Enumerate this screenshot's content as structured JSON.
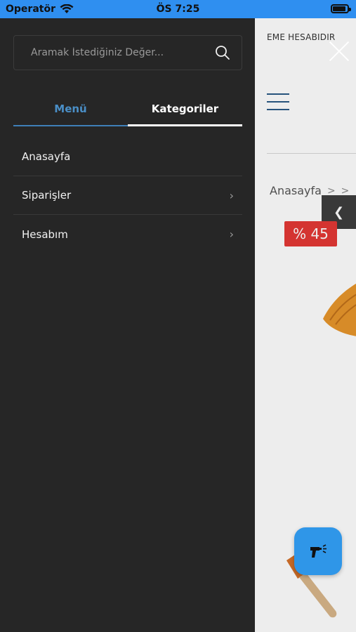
{
  "status_bar": {
    "carrier": "Operatör",
    "time": "ÖS 7:25",
    "battery_level": 0.9
  },
  "page": {
    "banner": "EME HESABIDIR",
    "breadcrumb": [
      "Anasayfa",
      ">",
      ">"
    ],
    "discount_badge": "% 45"
  },
  "drawer": {
    "search": {
      "placeholder": "Aramak İstediğiniz Değer..."
    },
    "tabs": [
      {
        "label": "Menü",
        "active": true
      },
      {
        "label": "Kategoriler",
        "active": false
      }
    ],
    "items": [
      {
        "label": "Anasayfa",
        "has_chevron": false
      },
      {
        "label": "Siparişler",
        "has_chevron": true,
        "chevron": "›"
      },
      {
        "label": "Hesabım",
        "has_chevron": true,
        "chevron": "›"
      }
    ]
  },
  "icons": {
    "search": "search-icon",
    "close": "close-icon",
    "menu": "hamburger-icon",
    "back": "chevron-left-icon",
    "fab": "spray-gun-icon"
  },
  "colors": {
    "status_bar": "#2f8ff0",
    "drawer_bg": "#262626",
    "accent": "#4a8fc7",
    "fab": "#2f96e8",
    "discount": "#e53935"
  }
}
